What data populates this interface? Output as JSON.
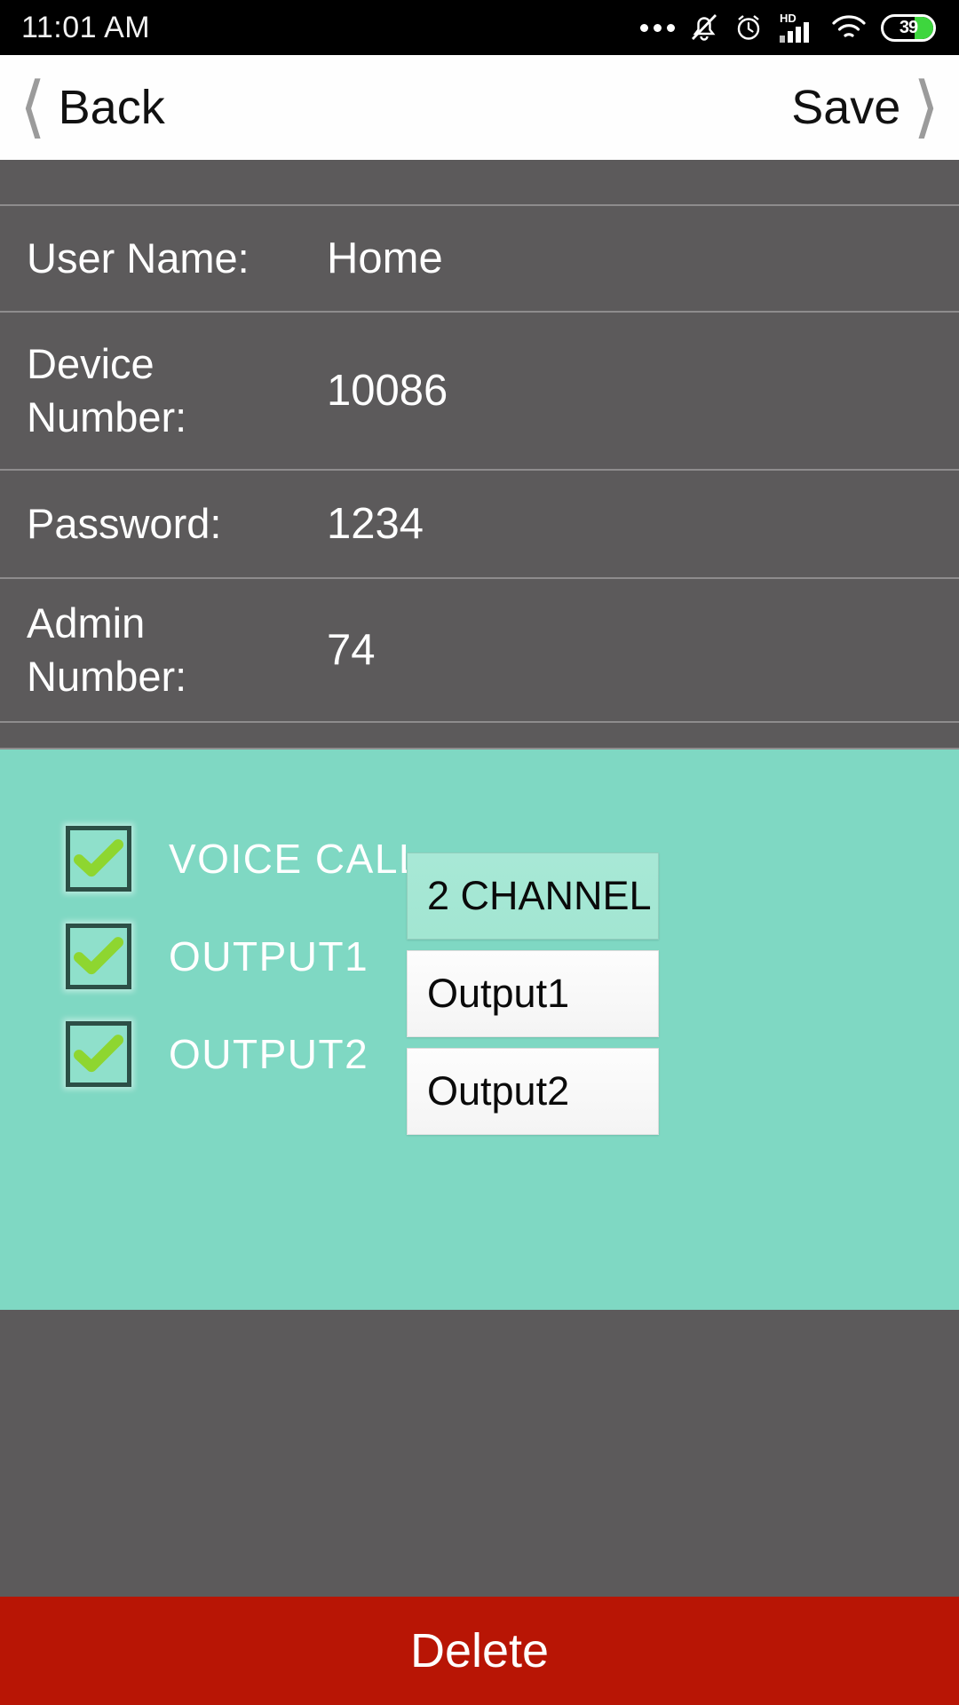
{
  "statusbar": {
    "time": "11:01 AM",
    "battery_percent": "39",
    "icons": [
      "more-dots-icon",
      "bell-muted-icon",
      "alarm-clock-icon",
      "hd-signal-icon",
      "wifi-icon",
      "battery-icon"
    ]
  },
  "navbar": {
    "back_label": "Back",
    "save_label": "Save"
  },
  "form": {
    "rows": [
      {
        "label": "User Name:",
        "value": "Home"
      },
      {
        "label": "Device Number:",
        "value": "10086"
      },
      {
        "label": "Password:",
        "value": "1234"
      },
      {
        "label": "Admin Number:",
        "value": "74"
      }
    ]
  },
  "options": {
    "items": [
      {
        "label": "VOICE CALL",
        "checked": true,
        "field_value": "2 CHANNEL"
      },
      {
        "label": "OUTPUT1",
        "checked": true,
        "field_value": "Output1"
      },
      {
        "label": "OUTPUT2",
        "checked": true,
        "field_value": "Output2"
      }
    ]
  },
  "footer": {
    "delete_label": "Delete"
  },
  "colors": {
    "teal_background": "#7fd8c3",
    "form_background": "#5c5a5b",
    "delete_red": "#b81505",
    "check_green": "#8ed630",
    "checkbox_border": "#2c4f46",
    "battery_green": "#3ed63e"
  }
}
